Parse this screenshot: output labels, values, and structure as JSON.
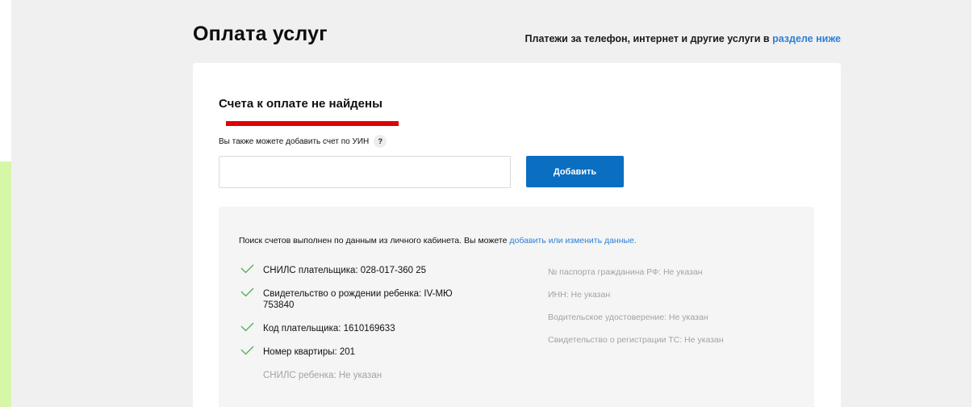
{
  "page": {
    "title": "Оплата услуг",
    "header_note": "Платежи за телефон, интернет и другие услуги в",
    "header_link": "разделе ниже"
  },
  "card": {
    "heading": "Счета к оплате не найдены",
    "uin_label": "Вы также можете добавить счет по УИН",
    "help_symbol": "?",
    "uin_input_value": "",
    "uin_input_placeholder": "",
    "add_button": "Добавить"
  },
  "info": {
    "text": "Поиск счетов выполнен по данным из личного кабинета. Вы можете",
    "link": "добавить или изменить данные.",
    "left_items": [
      {
        "label": "СНИЛС плательщика: 028-017-360 25",
        "checked": true
      },
      {
        "label": "Свидетельство о рождении ребенка: IV-МЮ 753840",
        "checked": true
      },
      {
        "label": "Код плательщика: 1610169633",
        "checked": true
      },
      {
        "label": "Номер квартиры: 201",
        "checked": true
      },
      {
        "label": "СНИЛС ребенка: Не указан",
        "checked": false
      }
    ],
    "right_items": [
      "№ паспорта гражданина РФ: Не указан",
      "ИНН: Не указан",
      "Водительское удостоверение: Не указан",
      "Свидетельство о регистрации ТС: Не указан"
    ]
  },
  "colors": {
    "link": "#2f7fd4",
    "button": "#0a6ec1",
    "check": "#4caf50",
    "redaction": "#e10000",
    "muted": "#a3a3a3"
  }
}
